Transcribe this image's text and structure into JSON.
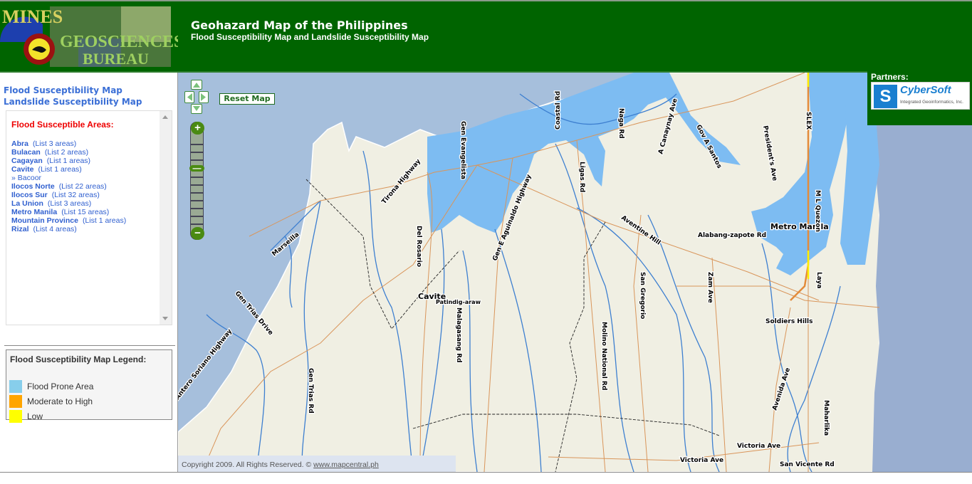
{
  "header": {
    "logo_text": "Mines and Geosciences Bureau",
    "title": "Geohazard Map of the Philippines",
    "subtitle": "Flood Susceptibility Map and Landslide Susceptibility Map"
  },
  "sidebar": {
    "links": [
      "Flood Susceptibility Map",
      "Landslide Susceptibility Map"
    ],
    "areas_title": "Flood Susceptible Areas:",
    "provinces": [
      {
        "name": "Abra",
        "count": "(List 3 areas)"
      },
      {
        "name": "Bulacan",
        "count": "(List 2 areas)"
      },
      {
        "name": "Cagayan",
        "count": "(List 1 areas)"
      },
      {
        "name": "Cavite",
        "count": "(List 1 areas)",
        "sub": "» Bacoor"
      },
      {
        "name": "Ilocos Norte",
        "count": "(List 22 areas)"
      },
      {
        "name": "Ilocos Sur",
        "count": "(List 32 areas)"
      },
      {
        "name": "La Union",
        "count": "(List 3 areas)"
      },
      {
        "name": "Metro Manila",
        "count": "(List 15 areas)"
      },
      {
        "name": "Mountain Province",
        "count": "(List 1 areas)"
      },
      {
        "name": "Rizal",
        "count": "(List 4 areas)"
      }
    ],
    "legend": {
      "title": "Flood Susceptibility Map Legend:",
      "items": [
        {
          "label": "Flood Prone Area",
          "color": "#87ceeb"
        },
        {
          "label": "Moderate to High",
          "color": "#ffa500"
        },
        {
          "label": "Low",
          "color": "#ffff00"
        }
      ]
    }
  },
  "map": {
    "reset_label": "Reset Map",
    "zoom_in": "+",
    "zoom_out": "−",
    "zoom_level_fraction": 0.25,
    "copyright": "Copyright 2009. All Rights Reserved. ©",
    "copyright_link": "www.mapcentral.ph",
    "colors": {
      "sea": "#a6bfdc",
      "land": "#f0efe3",
      "flood": "#7dbcf2",
      "road": "#d9955a",
      "river": "#3d7fd0"
    },
    "places": [
      "Metro Manila",
      "Cavite",
      "Soldiers Hills"
    ],
    "roads": [
      "Coastal Rd",
      "Naga Rd",
      "A Canaynay Ave",
      "Gov A Santos",
      "President's Ave",
      "SLEX",
      "Gen Evangelista",
      "Ligas Rd",
      "Tirona Highway",
      "Gen E Aguinaldo Highway",
      "Aventine Hill",
      "Alabang-zapote Rd",
      "M L Quezon",
      "Del Rosario",
      "Marseilla",
      "Gen Trias Drive",
      "San Gregorio",
      "Zam Ave",
      "Laya",
      "Patindig-araw",
      "Molino National Rd",
      "Malagasang Rd",
      "Gen Trias Rd",
      "Avenida Ave",
      "Maharlika",
      "Victoria Ave",
      "Victoria Ave",
      "San Vicente Rd",
      "Antero Soriano Highway"
    ]
  },
  "partners": {
    "label": "Partners:",
    "name": "CyberSoft",
    "tagline": "Integrated Geoinformatics, Inc."
  }
}
